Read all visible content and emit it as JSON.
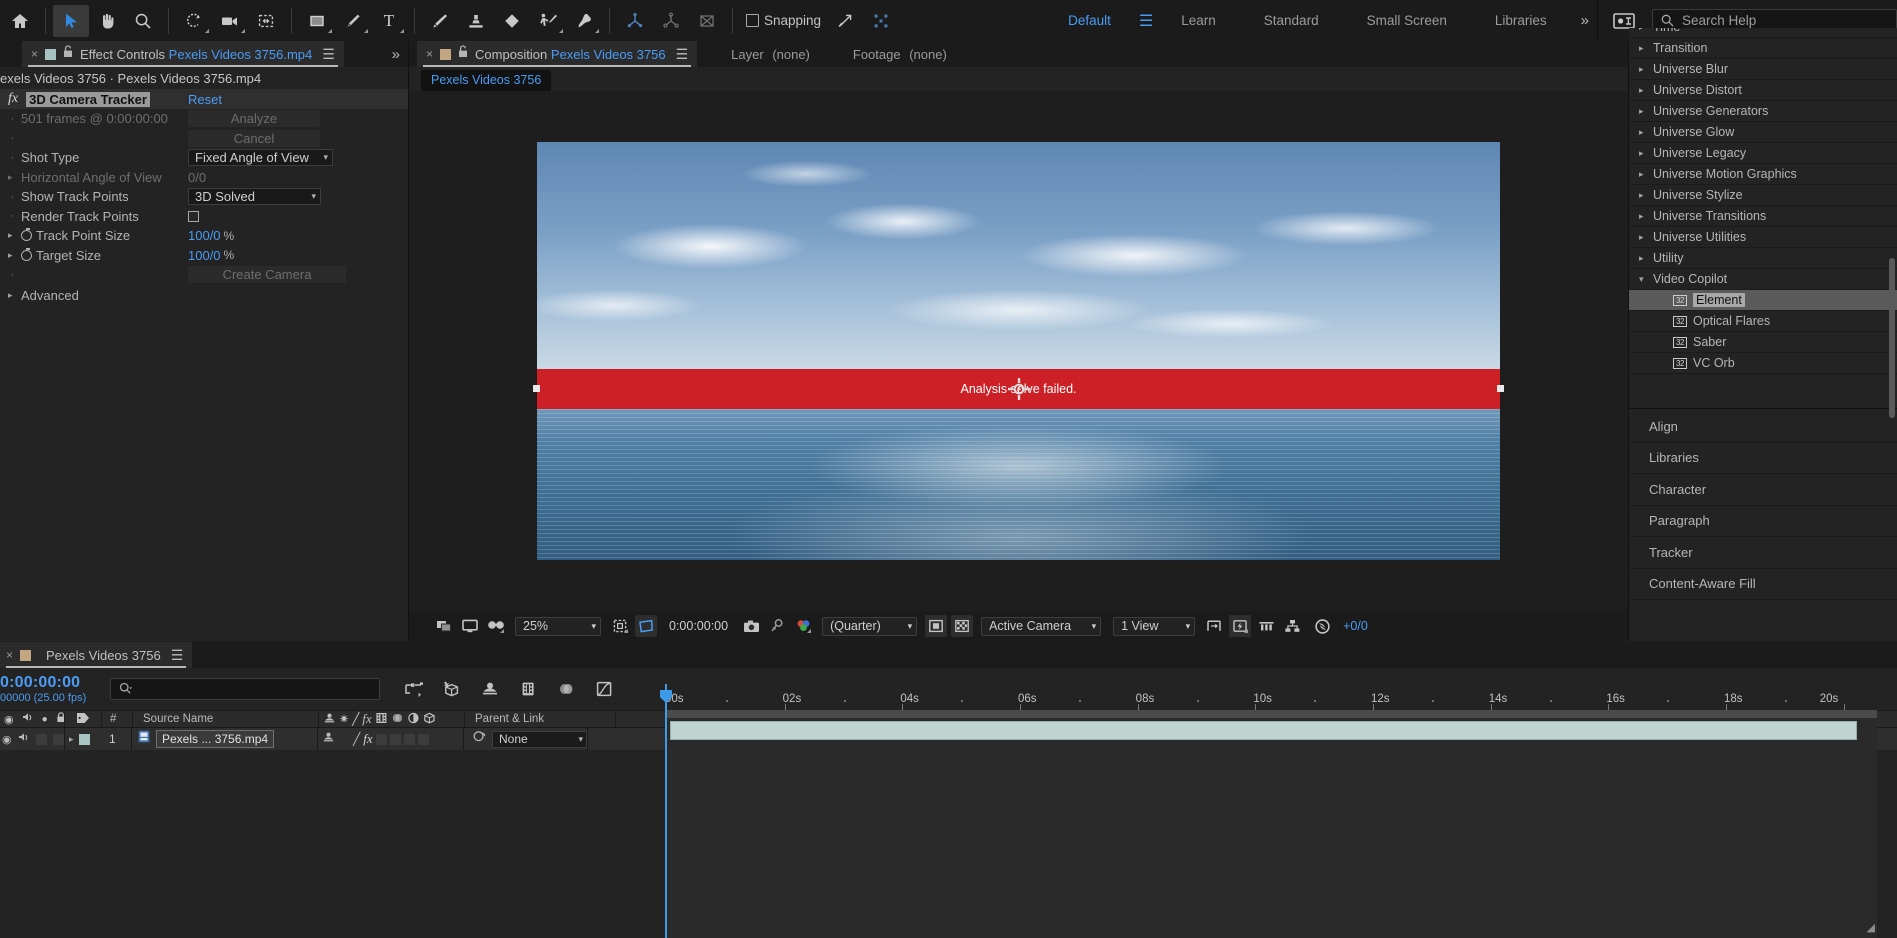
{
  "app": {
    "name": "Adobe After Effects"
  },
  "toolbar": {
    "tools": [
      {
        "name": "home-icon",
        "label": "Home"
      },
      {
        "name": "selection-tool-icon",
        "label": "Selection Tool"
      },
      {
        "name": "hand-tool-icon",
        "label": "Hand Tool"
      },
      {
        "name": "zoom-tool-icon",
        "label": "Zoom Tool"
      },
      {
        "name": "orbit-tool-icon",
        "label": "Orbit Tool"
      },
      {
        "name": "camera-tool-icon",
        "label": "Camera Tool"
      },
      {
        "name": "region-of-interest-icon",
        "label": "Region of Interest"
      },
      {
        "name": "shape-tool-icon",
        "label": "Rectangle Tool"
      },
      {
        "name": "pen-tool-icon",
        "label": "Pen Tool"
      },
      {
        "name": "type-tool-icon",
        "label": "Type Tool"
      },
      {
        "name": "brush-tool-icon",
        "label": "Brush Tool"
      },
      {
        "name": "clone-stamp-tool-icon",
        "label": "Clone Stamp Tool"
      },
      {
        "name": "eraser-tool-icon",
        "label": "Eraser Tool"
      },
      {
        "name": "roto-brush-tool-icon",
        "label": "Roto Brush Tool"
      },
      {
        "name": "puppet-pin-tool-icon",
        "label": "Puppet Pin Tool"
      }
    ],
    "axis_tools": [
      {
        "name": "local-axis-mode-icon",
        "label": "Local Axis Mode"
      },
      {
        "name": "world-axis-mode-icon",
        "label": "World Axis Mode"
      },
      {
        "name": "view-axis-mode-icon",
        "label": "View Axis Mode"
      }
    ],
    "snapping": {
      "label": "Snapping",
      "checked": false
    },
    "extra_tools": [
      {
        "name": "snapping-arrow-icon",
        "label": "Snap to features"
      },
      {
        "name": "transform-box-icon",
        "label": "Transform box"
      }
    ],
    "workspaces": [
      {
        "label": "Default",
        "selected": true
      },
      {
        "label": "Learn",
        "selected": false
      },
      {
        "label": "Standard",
        "selected": false
      },
      {
        "label": "Small Screen",
        "selected": false
      },
      {
        "label": "Libraries",
        "selected": false
      }
    ],
    "overflow_label": "»",
    "workspace_menu_icon": "hamburger-icon",
    "settings_icon": "workspace-settings-icon",
    "search": {
      "placeholder": "Search Help",
      "value": "Search Help",
      "icon": "search-icon"
    }
  },
  "effect_controls": {
    "tab": {
      "title_prefix": "Effect Controls",
      "title_item": "Pexels Videos 3756.mp4",
      "close_icon": "close-icon",
      "lock_icon": "lock-icon",
      "menu_icon": "panel-menu-icon"
    },
    "breadcrumb": "exels Videos 3756 · Pexels Videos 3756.mp4",
    "effect_name": "3D Camera Tracker",
    "reset_label": "Reset",
    "analysis_status": "501 frames @ 0:00:00:00",
    "analyze_label": "Analyze",
    "cancel_label": "Cancel",
    "create_camera_label": "Create Camera",
    "properties": [
      {
        "label": "Shot Type",
        "value": "Fixed Angle of View",
        "type": "dropdown"
      },
      {
        "label": "Horizontal Angle of View",
        "value": "0/0",
        "type": "number-dim"
      },
      {
        "label": "Show Track Points",
        "value": "3D Solved",
        "type": "dropdown"
      },
      {
        "label": "Render Track Points",
        "value": "",
        "type": "checkbox",
        "checked": false
      },
      {
        "label": "Track Point Size",
        "value": "100/0",
        "unit": "%",
        "type": "slider"
      },
      {
        "label": "Target Size",
        "value": "100/0",
        "unit": "%",
        "type": "slider"
      }
    ],
    "advanced_label": "Advanced"
  },
  "composition": {
    "tabs": [
      {
        "label_prefix": "Composition",
        "label_item": "Pexels Videos 3756",
        "selected": true,
        "close_icon": "close-icon",
        "lock_icon": "lock-icon",
        "menu_icon": "panel-menu-icon"
      },
      {
        "label_prefix": "Layer",
        "label_item": "(none)",
        "selected": false
      },
      {
        "label_prefix": "Footage",
        "label_item": "(none)",
        "selected": false
      }
    ],
    "active_subtab": "Pexels Videos 3756",
    "overlay_message": "Analysis solve failed.",
    "bottom_bar": {
      "icons": [
        {
          "name": "toggle-viewer-layout-icon"
        },
        {
          "name": "main-viewer-icon"
        },
        {
          "name": "3d-glasses-icon"
        }
      ],
      "magnification": "25%",
      "choose-grid-icon": "choose-grid-guide-icon",
      "mask-visibility-icon": "toggle-mask-visibility-icon",
      "timecode": "0:00:00:00",
      "snapshot_icon": "camera-snapshot-icon",
      "show_snapshot_icon": "show-snapshot-icon",
      "channel_icon": "show-channel-icon",
      "resolution": "(Quarter)",
      "region_of_interest_icon": "region-of-interest-icon",
      "transparency_grid_icon": "toggle-transparency-grid-icon",
      "camera_view": "Active Camera",
      "view_layout": "1 View",
      "pixel_aspect_icon": "pixel-aspect-correction-icon",
      "fast_previews_icon": "fast-previews-icon",
      "timeline_icon": "timeline-icon",
      "flowchart_icon": "comp-flowchart-icon",
      "reset_exposure_icon": "reset-exposure-icon",
      "exposure_value": "+0/0"
    }
  },
  "effects_panel": {
    "rows": [
      {
        "label": "Time",
        "indent": 0,
        "expanded": false,
        "selected": false,
        "clipped": true
      },
      {
        "label": "Transition",
        "indent": 0,
        "expanded": false,
        "selected": false
      },
      {
        "label": "Universe Blur",
        "indent": 0,
        "expanded": false,
        "selected": false
      },
      {
        "label": "Universe Distort",
        "indent": 0,
        "expanded": false,
        "selected": false
      },
      {
        "label": "Universe Generators",
        "indent": 0,
        "expanded": false,
        "selected": false
      },
      {
        "label": "Universe Glow",
        "indent": 0,
        "expanded": false,
        "selected": false
      },
      {
        "label": "Universe Legacy",
        "indent": 0,
        "expanded": false,
        "selected": false
      },
      {
        "label": "Universe Motion Graphics",
        "indent": 0,
        "expanded": false,
        "selected": false
      },
      {
        "label": "Universe Stylize",
        "indent": 0,
        "expanded": false,
        "selected": false
      },
      {
        "label": "Universe Transitions",
        "indent": 0,
        "expanded": false,
        "selected": false
      },
      {
        "label": "Universe Utilities",
        "indent": 0,
        "expanded": false,
        "selected": false
      },
      {
        "label": "Utility",
        "indent": 0,
        "expanded": false,
        "selected": false
      },
      {
        "label": "Video Copilot",
        "indent": 0,
        "expanded": true,
        "selected": false
      },
      {
        "label": "Element",
        "indent": 1,
        "badge": "32",
        "selected": true
      },
      {
        "label": "Optical Flares",
        "indent": 1,
        "badge": "32",
        "selected": false
      },
      {
        "label": "Saber",
        "indent": 1,
        "badge": "32",
        "selected": false
      },
      {
        "label": "VC Orb",
        "indent": 1,
        "badge": "32",
        "selected": false
      }
    ]
  },
  "panel_stack": {
    "items": [
      "Align",
      "Libraries",
      "Character",
      "Paragraph",
      "Tracker",
      "Content-Aware Fill"
    ]
  },
  "timeline": {
    "tab": {
      "label": "Pexels Videos 3756",
      "menu_icon": "panel-menu-icon",
      "swatch_color": "#c3a782"
    },
    "current_time": "0:00:00:00",
    "frame_info": "00000 (25.00 fps)",
    "search": {
      "placeholder": "",
      "value": "",
      "icon": "search-magnifier-icon"
    },
    "control_icons": [
      {
        "name": "composition-mini-flowchart-icon"
      },
      {
        "name": "draft-3d-icon"
      },
      {
        "name": "hide-shy-layers-icon"
      },
      {
        "name": "frame-blending-icon"
      },
      {
        "name": "motion-blur-icon"
      },
      {
        "name": "graph-editor-icon"
      }
    ],
    "columns": {
      "av_features": [
        "video-icon",
        "audio-icon",
        "solo-icon",
        "lock-icon"
      ],
      "label_icon": "label-color-icon",
      "index": "#",
      "source_name": "Source Name",
      "switches": [
        "shy-icon",
        "collapse-transformations-icon",
        "quality-icon",
        "effects-icon",
        "frame-blending-icon",
        "motion-blur-icon",
        "adjustment-layer-icon",
        "3d-layer-icon"
      ],
      "parent_and_link": "Parent & Link"
    },
    "layers": [
      {
        "index": "1",
        "name": "Pexels ... 3756.mp4",
        "label_color": "#a8c4c2",
        "parent": "None",
        "video_on": true,
        "icons": [
          "footage-source-icon",
          "collapse-icon",
          "quality-slash-icon",
          "fx-icon"
        ],
        "bar_color": "#bfd4d1"
      }
    ],
    "ruler": {
      "labels": [
        "00s",
        "02s",
        "04s",
        "06s",
        "08s",
        "10s",
        "12s",
        "14s",
        "16s",
        "18s",
        "20s"
      ],
      "start_seconds": 0,
      "end_seconds": 20.6
    }
  },
  "colors": {
    "accent_blue": "#4b9cf5",
    "panel_bg": "#232323",
    "toolbar_bg": "#1b1b1b",
    "error_red": "#cc2026",
    "layer_bar": "#bfd4d1",
    "playhead": "#3c9ae8"
  }
}
